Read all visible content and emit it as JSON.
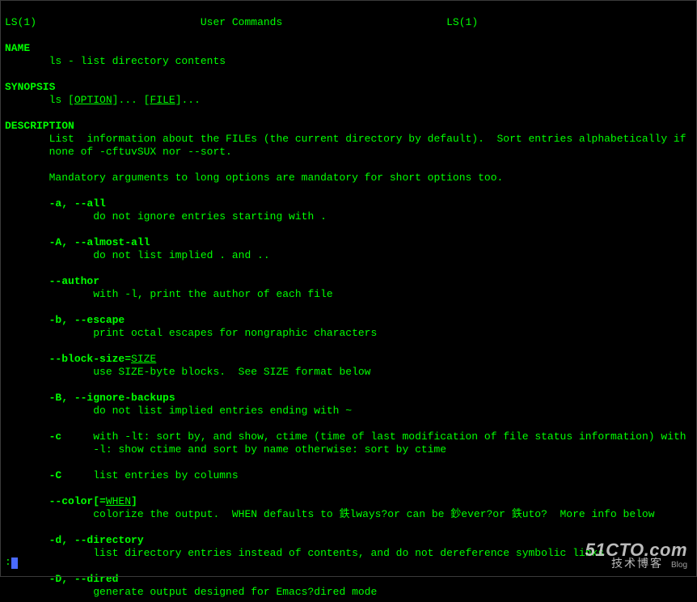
{
  "header": {
    "left": "LS(1)",
    "center": "User Commands",
    "right": "LS(1)"
  },
  "name": {
    "heading": "NAME",
    "text": "ls - list directory contents"
  },
  "synopsis": {
    "heading": "SYNOPSIS",
    "cmd": "ls",
    "opt_bracket_open": "[",
    "option_word": "OPTION",
    "opt_bracket_close": "]... [",
    "file_word": "FILE",
    "tail": "]..."
  },
  "description": {
    "heading": "DESCRIPTION",
    "intro1": "List  information about the FILEs (the current directory by default).  Sort entries alphabetically if",
    "intro2": "none of -cftuvSUX nor --sort.",
    "mandatory": "Mandatory arguments to long options are mandatory for short options too.",
    "opts": {
      "a": {
        "flag": "-a, --all",
        "desc": "do not ignore entries starting with ."
      },
      "A": {
        "flag": "-A, --almost-all",
        "desc": "do not list implied . and .."
      },
      "author": {
        "flag": "--author",
        "desc": "with -l, print the author of each file"
      },
      "b": {
        "flag": "-b, --escape",
        "desc": "print octal escapes for nongraphic characters"
      },
      "block": {
        "flag_prefix": "--block-size=",
        "flag_arg": "SIZE",
        "desc": "use SIZE-byte blocks.  See SIZE format below"
      },
      "B": {
        "flag": "-B, --ignore-backups",
        "desc": "do not list implied entries ending with ~"
      },
      "c": {
        "flag": "-c",
        "desc1": "with -lt: sort by, and show, ctime (time of last modification of file status information) with",
        "desc2": "-l: show ctime and sort by name otherwise: sort by ctime"
      },
      "C": {
        "flag": "-C",
        "desc": "list entries by columns"
      },
      "color": {
        "flag_prefix": "--color[=",
        "flag_arg": "WHEN",
        "flag_suffix": "]",
        "desc": "colorize the output.  WHEN defaults to 鉄lways?or can be 鈔ever?or 鉄uto?  More info below"
      },
      "d": {
        "flag": "-d, --directory",
        "desc": "list directory entries instead of contents, and do not dereference symbolic links"
      },
      "D": {
        "flag": "-D, --dired",
        "desc": "generate output designed for Emacs?dired mode"
      }
    }
  },
  "prompt": {
    "char": ":"
  },
  "watermark": {
    "line1": "51CTO.com",
    "line2": "技术博客",
    "blog": "Blog"
  }
}
